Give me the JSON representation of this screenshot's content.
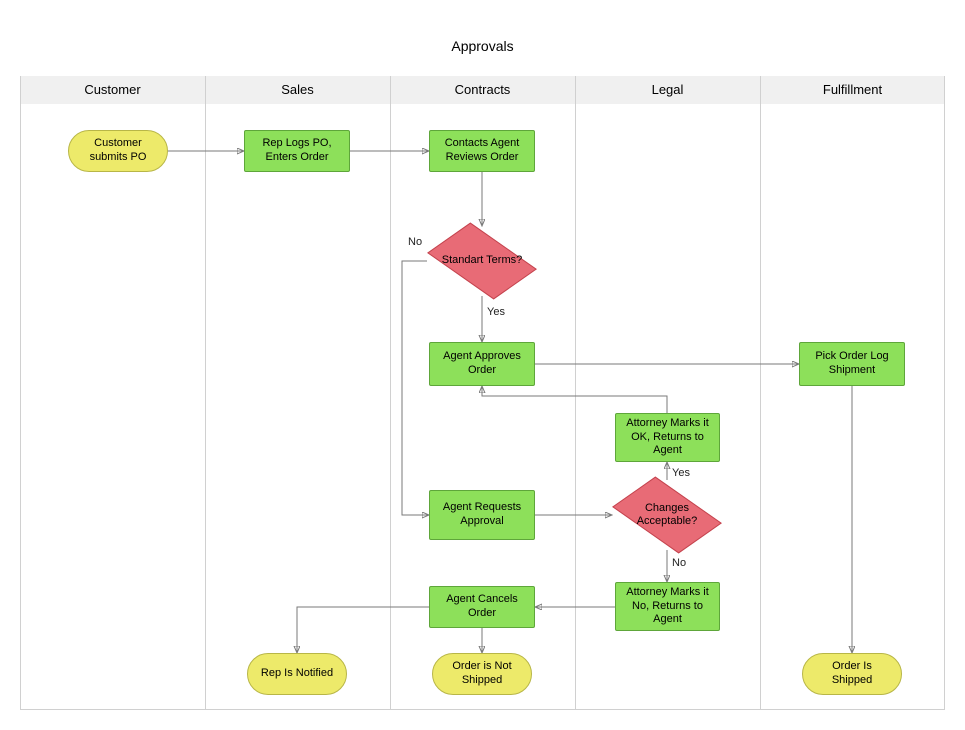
{
  "title": "Approvals",
  "lanes": {
    "customer": "Customer",
    "sales": "Sales",
    "contracts": "Contracts",
    "legal": "Legal",
    "fulfillment": "Fulfillment"
  },
  "nodes": {
    "customer_submits": "Customer submits PO",
    "rep_logs": "Rep Logs PO, Enters Order",
    "contacts_agent": "Contacts Agent Reviews Order",
    "standard_terms": "Standart Terms?",
    "agent_approves": "Agent Approves Order",
    "agent_requests": "Agent Requests Approval",
    "agent_cancels": "Agent Cancels Order",
    "attorney_ok": "Attorney Marks it OK, Returns to Agent",
    "changes_acceptable": "Changes Acceptable?",
    "attorney_no": "Attorney Marks it No, Returns to Agent",
    "pick_order": "Pick Order Log Shipment",
    "rep_notified": "Rep Is Notified",
    "order_not_shipped": "Order is Not Shipped",
    "order_shipped": "Order Is Shipped"
  },
  "edge_labels": {
    "no": "No",
    "yes": "Yes",
    "yes2": "Yes",
    "no2": "No"
  }
}
